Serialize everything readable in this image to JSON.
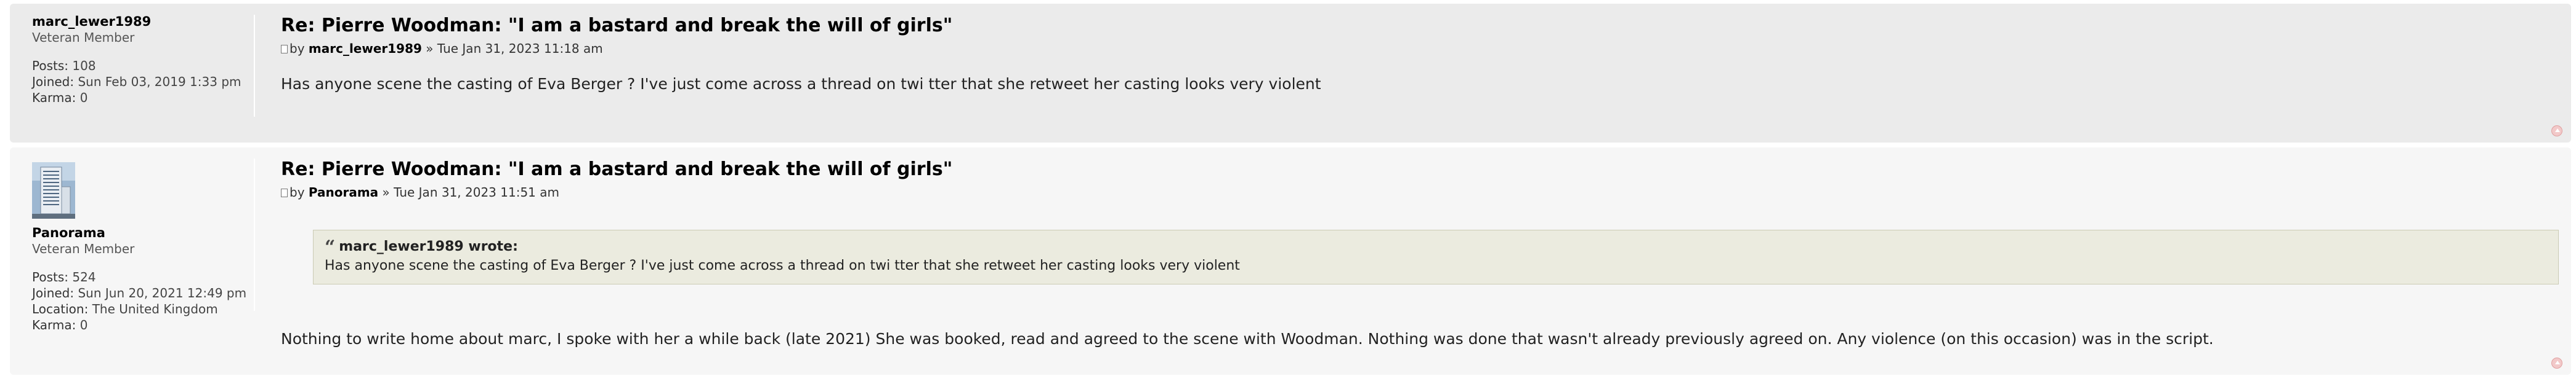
{
  "posts": [
    {
      "username": "marc_lewer1989",
      "rank": "Veteran Member",
      "stats": [
        {
          "label": "Posts:",
          "value": "108"
        },
        {
          "label": "Joined:",
          "value": "Sun Feb 03, 2019 1:33 pm"
        },
        {
          "label": "Karma:",
          "value": "0"
        }
      ],
      "title": "Re: Pierre Woodman: \"I am a bastard and break the will of girls\"",
      "by_prefix": "by",
      "author": "marc_lewer1989",
      "date": "» Tue Jan 31, 2023 11:18 am",
      "content": "Has anyone scene the casting of Eva Berger ? I've just come across a thread on twi tter that she retweet her casting looks very violent"
    },
    {
      "username": "Panorama",
      "rank": "Veteran Member",
      "stats": [
        {
          "label": "Posts:",
          "value": "524"
        },
        {
          "label": "Joined:",
          "value": "Sun Jun 20, 2021 12:49 pm"
        },
        {
          "label": "Location:",
          "value": "The United Kingdom"
        },
        {
          "label": "Karma:",
          "value": "0"
        }
      ],
      "title": "Re: Pierre Woodman: \"I am a bastard and break the will of girls\"",
      "by_prefix": "by",
      "author": "Panorama",
      "date": "» Tue Jan 31, 2023 11:51 am",
      "quote_author": "marc_lewer1989 wrote:",
      "quote_text": "Has anyone scene the casting of Eva Berger ? I've just come across a thread on twi tter that she retweet her casting looks very violent",
      "content": "Nothing to write home about marc, I spoke with her a while back (late 2021) She was booked, read and agreed to the scene with Woodman. Nothing was done that wasn't already previously agreed on. Any violence (on this occasion) was in the script."
    }
  ],
  "icons": {
    "post": "document-icon",
    "top": "back-to-top-icon",
    "quote": "quote-icon"
  },
  "colors": {
    "post_bg_1": "#ebebeb",
    "post_bg_2": "#f6f6f6",
    "quote_bg": "#ebebdf",
    "top_button": "#f2c9c9"
  }
}
